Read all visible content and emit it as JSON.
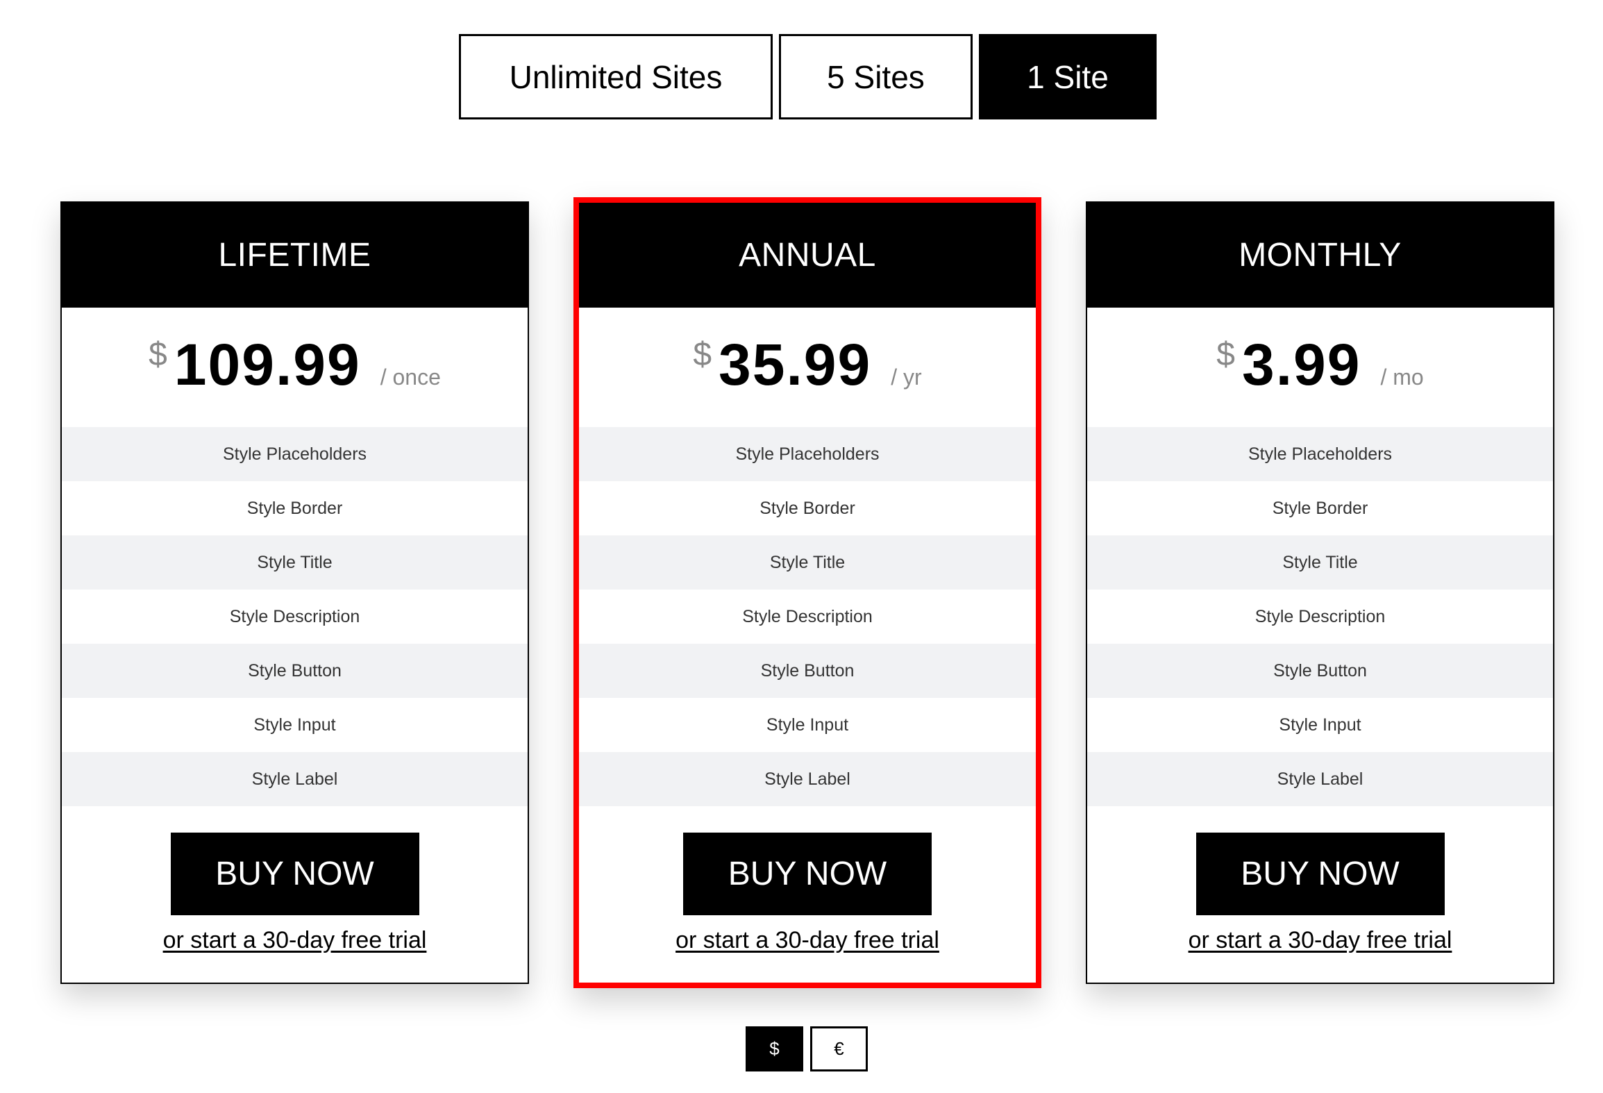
{
  "site_toggle": {
    "options": [
      {
        "label": "Unlimited Sites",
        "active": false
      },
      {
        "label": "5 Sites",
        "active": false
      },
      {
        "label": "1 Site",
        "active": true
      }
    ]
  },
  "plans": [
    {
      "title": "LIFETIME",
      "currency_symbol": "$",
      "price": "109.99",
      "period": "/ once",
      "highlighted": false,
      "features": [
        "Style Placeholders",
        "Style Border",
        "Style Title",
        "Style Description",
        "Style Button",
        "Style Input",
        "Style Label"
      ],
      "buy_label": "BUY NOW",
      "trial_label": "or start a 30-day free trial"
    },
    {
      "title": "ANNUAL",
      "currency_symbol": "$",
      "price": "35.99",
      "period": "/ yr",
      "highlighted": true,
      "features": [
        "Style Placeholders",
        "Style Border",
        "Style Title",
        "Style Description",
        "Style Button",
        "Style Input",
        "Style Label"
      ],
      "buy_label": "BUY NOW",
      "trial_label": "or start a 30-day free trial"
    },
    {
      "title": "MONTHLY",
      "currency_symbol": "$",
      "price": "3.99",
      "period": "/ mo",
      "highlighted": false,
      "features": [
        "Style Placeholders",
        "Style Border",
        "Style Title",
        "Style Description",
        "Style Button",
        "Style Input",
        "Style Label"
      ],
      "buy_label": "BUY NOW",
      "trial_label": "or start a 30-day free trial"
    }
  ],
  "currency_toggle": {
    "options": [
      {
        "label": "$",
        "active": true
      },
      {
        "label": "€",
        "active": false
      }
    ]
  },
  "colors": {
    "highlight_border": "#ff0000",
    "header_bg": "#000000",
    "feature_row_alt": "#f1f2f4",
    "muted_text": "#888888"
  }
}
